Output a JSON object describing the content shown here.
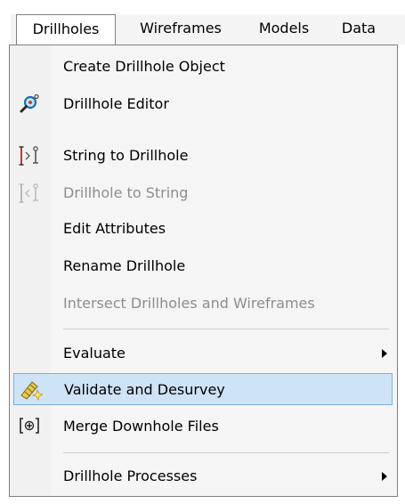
{
  "menubar": {
    "drillholes": "Drillholes",
    "wireframes": "Wireframes",
    "models": "Models",
    "data": "Data"
  },
  "menu": {
    "create_drillhole_object": "Create Drillhole Object",
    "drillhole_editor": "Drillhole Editor",
    "string_to_drillhole": "String to Drillhole",
    "drillhole_to_string": "Drillhole to String",
    "edit_attributes": "Edit Attributes",
    "rename_drillhole": "Rename Drillhole",
    "intersect_drillholes_wireframes": "Intersect Drillholes and Wireframes",
    "evaluate": "Evaluate",
    "validate_and_desurvey": "Validate and Desurvey",
    "merge_downhole_files": "Merge Downhole Files",
    "drillhole_processes": "Drillhole Processes"
  },
  "icons": {
    "drillhole_editor": "magnifier-icon",
    "string_to_drillhole": "string-to-drillhole-icon",
    "drillhole_to_string": "drillhole-to-string-icon",
    "validate_and_desurvey": "validate-icon",
    "merge_downhole_files": "merge-files-icon"
  },
  "colors": {
    "highlight_fill": "#cfe3f7",
    "highlight_border": "#7eaedd",
    "disabled_text": "#8d8d8d"
  }
}
